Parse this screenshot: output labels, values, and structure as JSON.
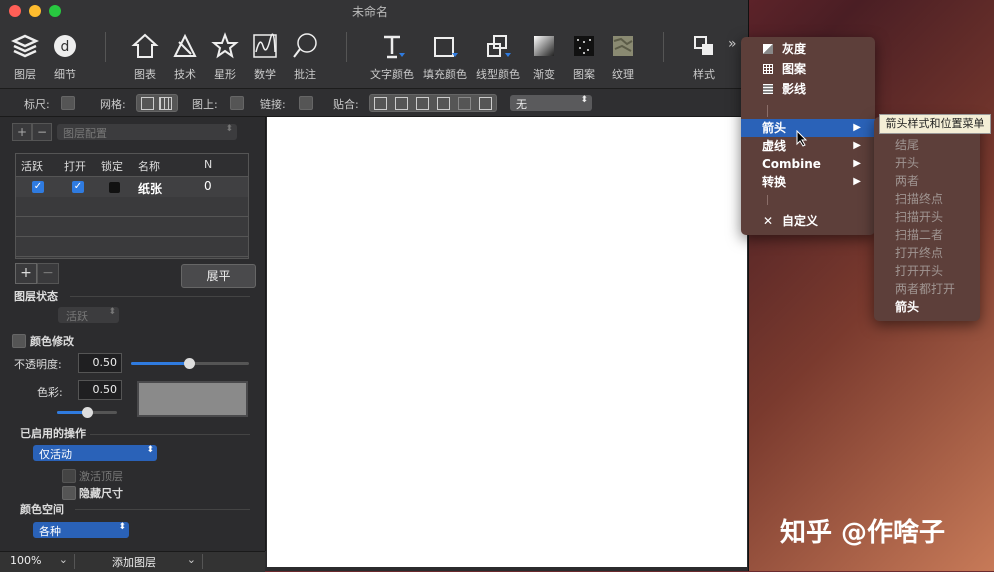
{
  "window": {
    "title": "未命名"
  },
  "toolbar": {
    "items": [
      {
        "label": "图层",
        "icon": "layers-icon"
      },
      {
        "label": "细节",
        "icon": "details-icon"
      },
      {
        "label": "图表",
        "icon": "chart-icon"
      },
      {
        "label": "技术",
        "icon": "tech-icon"
      },
      {
        "label": "星形",
        "icon": "star-icon"
      },
      {
        "label": "数学",
        "icon": "math-icon"
      },
      {
        "label": "批注",
        "icon": "annotation-icon"
      },
      {
        "label": "文字颜色",
        "icon": "text-color-icon"
      },
      {
        "label": "填充颜色",
        "icon": "fill-color-icon"
      },
      {
        "label": "线型颜色",
        "icon": "line-color-icon"
      },
      {
        "label": "渐变",
        "icon": "gradient-icon"
      },
      {
        "label": "图案",
        "icon": "pattern-icon"
      },
      {
        "label": "纹理",
        "icon": "texture-icon"
      },
      {
        "label": "样式",
        "icon": "style-icon"
      }
    ],
    "overflow": "»"
  },
  "optbar": {
    "ruler_label": "标尺:",
    "grid_label": "网格:",
    "on_top_label": "图上:",
    "link_label": "链接:",
    "snap_label": "贴合:",
    "snap_value": "无"
  },
  "leftpanel": {
    "layer_config": "图层配置",
    "table": {
      "headers": [
        "活跃",
        "打开",
        "锁定",
        "名称",
        "N"
      ],
      "row": {
        "name": "纸张",
        "n": "0"
      }
    },
    "flatten_button": "展平",
    "layer_state_title": "图层状态",
    "layer_state_value": "活跃",
    "color_modify_label": "颜色修改",
    "opacity_label": "不透明度:",
    "opacity_value": "0.50",
    "opacity_level": 0.5,
    "color_label": "色彩:",
    "color_value": "0.50",
    "color_level": 0.5,
    "enabled_ops_title": "已启用的操作",
    "enabled_ops_value": "仅活动",
    "activate_top_label": "激活顶层",
    "hide_size_label": "隐藏尺寸",
    "color_space_title": "颜色空间",
    "color_space_value": "各种"
  },
  "statusbar": {
    "zoom": "100%",
    "add_layer": "添加图层"
  },
  "menu": {
    "items": [
      {
        "label": "灰度",
        "icon": "grayscale-icon"
      },
      {
        "label": "图案",
        "icon": "pattern-grid-icon"
      },
      {
        "label": "影线",
        "icon": "hatch-icon"
      },
      {
        "label": "箭头",
        "submenu": true,
        "highlighted": true
      },
      {
        "label": "虚线",
        "submenu": true
      },
      {
        "label": "Combine",
        "submenu": true
      },
      {
        "label": "转换",
        "submenu": true
      },
      {
        "label": "自定义",
        "icon": "custom-tools-icon"
      }
    ],
    "submenu_arrow": "▶"
  },
  "submenu": {
    "tooltip": "箭头样式和位置菜单",
    "items": [
      "结尾",
      "开头",
      "两者",
      "扫描终点",
      "扫描开头",
      "扫描二者",
      "打开终点",
      "打开开头",
      "两者都打开",
      "箭头"
    ]
  },
  "watermark": "知乎 @作啥子",
  "colors": {
    "accent": "#2f7be0",
    "menu_bg": "#5d3f3a",
    "highlight": "#2a62b8"
  }
}
